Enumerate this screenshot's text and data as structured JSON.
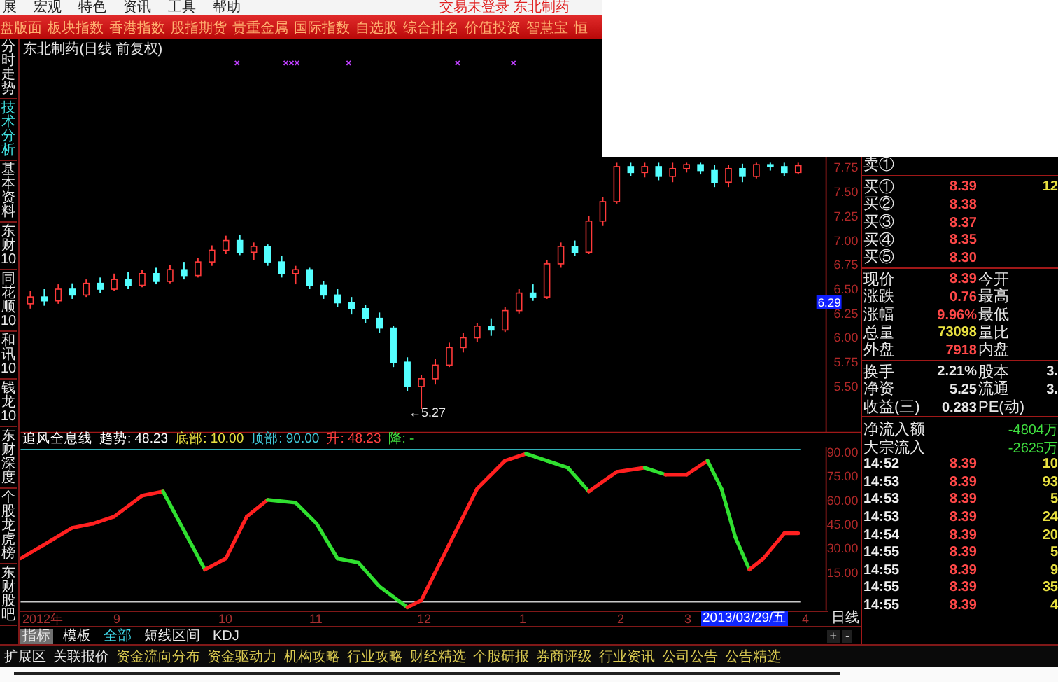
{
  "menu_bar": {
    "items": [
      "展",
      "宏观",
      "特色",
      "资讯",
      "工具",
      "帮助"
    ],
    "status": "交易未登录 东北制药"
  },
  "top_tabs": [
    "盘版面",
    "板块指数",
    "香港指数",
    "股指期货",
    "贵重金属",
    "国际指数",
    "自选股",
    "综合排名",
    "价值投资",
    "智慧宝",
    "恒"
  ],
  "side_tabs": [
    {
      "label": "分时走势",
      "selected": false
    },
    {
      "label": "技术分析",
      "selected": true
    },
    {
      "label": "基本资料",
      "selected": false
    },
    {
      "label": "东财10",
      "selected": false
    },
    {
      "label": "同花顺10",
      "selected": false
    },
    {
      "label": "和讯10",
      "selected": false
    },
    {
      "label": "钱龙10",
      "selected": false
    },
    {
      "label": "东财深度",
      "selected": false
    },
    {
      "label": "个股龙虎榜",
      "selected": false
    },
    {
      "label": "东财股吧",
      "selected": false
    }
  ],
  "price_chart": {
    "title": "东北制药(日线 前复权)",
    "price_marker": "6.29",
    "low_label": "←5.27",
    "chart_data": {
      "type": "candlestick",
      "ylim": [
        5.02,
        9.07
      ],
      "yticks": [
        {
          "value": 7.75,
          "label": "7.75"
        },
        {
          "value": 7.5,
          "label": "7.50"
        },
        {
          "value": 7.25,
          "label": "7.25"
        },
        {
          "value": 7.0,
          "label": "7.00"
        },
        {
          "value": 6.75,
          "label": "6.75"
        },
        {
          "value": 6.5,
          "label": "6.50"
        },
        {
          "value": 6.25,
          "label": "6.25"
        },
        {
          "value": 6.0,
          "label": "6.00"
        },
        {
          "value": 5.75,
          "label": "5.75"
        },
        {
          "value": 5.5,
          "label": "5.50"
        }
      ],
      "ohlc": [
        [
          6.35,
          6.48,
          6.3,
          6.42
        ],
        [
          6.42,
          6.5,
          6.33,
          6.38
        ],
        [
          6.38,
          6.55,
          6.35,
          6.5
        ],
        [
          6.5,
          6.56,
          6.4,
          6.44
        ],
        [
          6.44,
          6.6,
          6.42,
          6.56
        ],
        [
          6.56,
          6.62,
          6.46,
          6.5
        ],
        [
          6.5,
          6.66,
          6.48,
          6.6
        ],
        [
          6.6,
          6.68,
          6.5,
          6.54
        ],
        [
          6.54,
          6.7,
          6.52,
          6.66
        ],
        [
          6.66,
          6.72,
          6.55,
          6.58
        ],
        [
          6.58,
          6.75,
          6.56,
          6.7
        ],
        [
          6.7,
          6.78,
          6.6,
          6.64
        ],
        [
          6.64,
          6.82,
          6.62,
          6.78
        ],
        [
          6.78,
          6.95,
          6.74,
          6.9
        ],
        [
          6.9,
          7.05,
          6.86,
          7.0
        ],
        [
          7.0,
          7.06,
          6.85,
          6.88
        ],
        [
          6.88,
          6.98,
          6.8,
          6.94
        ],
        [
          6.94,
          6.96,
          6.74,
          6.78
        ],
        [
          6.78,
          6.84,
          6.62,
          6.66
        ],
        [
          6.66,
          6.74,
          6.55,
          6.7
        ],
        [
          6.7,
          6.72,
          6.5,
          6.54
        ],
        [
          6.54,
          6.58,
          6.4,
          6.44
        ],
        [
          6.44,
          6.5,
          6.32,
          6.36
        ],
        [
          6.36,
          6.42,
          6.24,
          6.3
        ],
        [
          6.3,
          6.34,
          6.15,
          6.2
        ],
        [
          6.2,
          6.26,
          6.05,
          6.1
        ],
        [
          6.1,
          6.12,
          5.7,
          5.75
        ],
        [
          5.75,
          5.8,
          5.45,
          5.5
        ],
        [
          5.5,
          5.62,
          5.27,
          5.58
        ],
        [
          5.58,
          5.78,
          5.52,
          5.72
        ],
        [
          5.72,
          5.95,
          5.7,
          5.9
        ],
        [
          5.9,
          6.05,
          5.85,
          6.0
        ],
        [
          6.0,
          6.15,
          5.96,
          6.12
        ],
        [
          6.12,
          6.2,
          6.02,
          6.08
        ],
        [
          6.08,
          6.32,
          6.06,
          6.28
        ],
        [
          6.28,
          6.5,
          6.25,
          6.46
        ],
        [
          6.46,
          6.55,
          6.38,
          6.42
        ],
        [
          6.42,
          6.8,
          6.4,
          6.76
        ],
        [
          6.76,
          6.98,
          6.72,
          6.94
        ],
        [
          6.94,
          7.0,
          6.84,
          6.88
        ],
        [
          6.88,
          7.25,
          6.86,
          7.2
        ],
        [
          7.2,
          7.45,
          7.15,
          7.4
        ],
        [
          7.4,
          7.8,
          7.38,
          7.76
        ],
        [
          7.76,
          7.8,
          7.66,
          7.7
        ],
        [
          7.7,
          7.8,
          7.65,
          7.76
        ],
        [
          7.76,
          7.8,
          7.62,
          7.66
        ],
        [
          7.66,
          7.8,
          7.6,
          7.74
        ],
        [
          7.74,
          7.8,
          7.7,
          7.78
        ],
        [
          7.78,
          7.8,
          7.68,
          7.72
        ],
        [
          7.72,
          7.78,
          7.55,
          7.6
        ],
        [
          7.6,
          7.78,
          7.55,
          7.74
        ],
        [
          7.74,
          7.79,
          7.6,
          7.66
        ],
        [
          7.66,
          7.8,
          7.64,
          7.78
        ],
        [
          7.78,
          7.8,
          7.72,
          7.76
        ],
        [
          7.76,
          7.8,
          7.66,
          7.7
        ],
        [
          7.7,
          7.8,
          7.68,
          7.77
        ]
      ]
    }
  },
  "indicator": {
    "fields": [
      {
        "kind": "name",
        "text": "追风全息线"
      },
      {
        "kind": "trend",
        "text": "趋势: 48.23"
      },
      {
        "kind": "bottom",
        "text": "底部: 10.00"
      },
      {
        "kind": "top",
        "text": "顶部: 90.00"
      },
      {
        "kind": "rise",
        "text": "升: 48.23"
      },
      {
        "kind": "fall",
        "text": "降: -"
      }
    ],
    "axis": [
      "90.00",
      "75.00",
      "60.00",
      "45.00",
      "30.00",
      "15.00"
    ]
  },
  "date_axis": {
    "labels": [
      "2012年",
      "9",
      "10",
      "11",
      "12",
      "1",
      "2",
      "3",
      "4"
    ],
    "cursor_date": "2013/03/29/五",
    "period": "日线"
  },
  "indicator_tabs": [
    {
      "label": "指标",
      "selected": true,
      "active": false
    },
    {
      "label": "模板",
      "selected": false,
      "active": false
    },
    {
      "label": "全部",
      "selected": false,
      "active": true
    },
    {
      "label": "短线区间",
      "selected": false,
      "active": false
    },
    {
      "label": "KDJ",
      "selected": false,
      "active": false
    }
  ],
  "zoom_buttons": [
    "+",
    "-"
  ],
  "quote_panel": {
    "asks": [
      {
        "label": "卖①"
      }
    ],
    "bids": [
      {
        "label": "买①",
        "price": "8.39",
        "volume": "12"
      },
      {
        "label": "买②",
        "price": "8.38"
      },
      {
        "label": "买③",
        "price": "8.37"
      },
      {
        "label": "买④",
        "price": "8.35"
      },
      {
        "label": "买⑤",
        "price": "8.30"
      }
    ],
    "stats": [
      {
        "label": "现价",
        "value": "8.39",
        "kind": "up",
        "label2": "今开"
      },
      {
        "label": "涨跌",
        "value": "0.76",
        "kind": "up",
        "label2": "最高"
      },
      {
        "label": "涨幅",
        "value": "9.96%",
        "kind": "up",
        "label2": "最低"
      },
      {
        "label": "总量",
        "value": "73098",
        "kind": "volume",
        "label2": "量比"
      },
      {
        "label": "外盘",
        "value": "7918",
        "kind": "up",
        "label2": "内盘"
      }
    ],
    "stats2": [
      {
        "label": "换手",
        "value": "2.21%",
        "label2": "股本",
        "value2": "3."
      },
      {
        "label": "净资",
        "value": "5.25",
        "label2": "流通",
        "value2": "3."
      },
      {
        "label": "收益(三)",
        "value": "0.283",
        "label2": "PE(动)"
      }
    ],
    "flows": [
      {
        "label": "净流入额",
        "value": "-4804万"
      },
      {
        "label": "大宗流入",
        "value": "-2625万"
      }
    ],
    "ticks": [
      {
        "time": "14:52",
        "price": "8.39",
        "volume": "10"
      },
      {
        "time": "14:53",
        "price": "8.39",
        "volume": "93"
      },
      {
        "time": "14:53",
        "price": "8.39",
        "volume": "5"
      },
      {
        "time": "14:53",
        "price": "8.39",
        "volume": "24"
      },
      {
        "time": "14:54",
        "price": "8.39",
        "volume": "20"
      },
      {
        "time": "14:55",
        "price": "8.39",
        "volume": "5"
      },
      {
        "time": "14:55",
        "price": "8.39",
        "volume": "9"
      },
      {
        "time": "14:55",
        "price": "8.39",
        "volume": "35"
      },
      {
        "time": "14:55",
        "price": "8.39",
        "volume": "4"
      }
    ]
  },
  "bottom_links": [
    {
      "label": "扩展区",
      "kind": "plain"
    },
    {
      "label": "关联报价",
      "kind": "plain"
    },
    {
      "label": "资金流向分布",
      "kind": "link"
    },
    {
      "label": "资金驱动力",
      "kind": "link"
    },
    {
      "label": "机构攻略",
      "kind": "link"
    },
    {
      "label": "行业攻略",
      "kind": "link"
    },
    {
      "label": "财经精选",
      "kind": "link"
    },
    {
      "label": "个股研报",
      "kind": "link"
    },
    {
      "label": "券商评级",
      "kind": "link"
    },
    {
      "label": "行业资讯",
      "kind": "link"
    },
    {
      "label": "公司公告",
      "kind": "link"
    },
    {
      "label": "公告精选",
      "kind": "link"
    }
  ]
}
